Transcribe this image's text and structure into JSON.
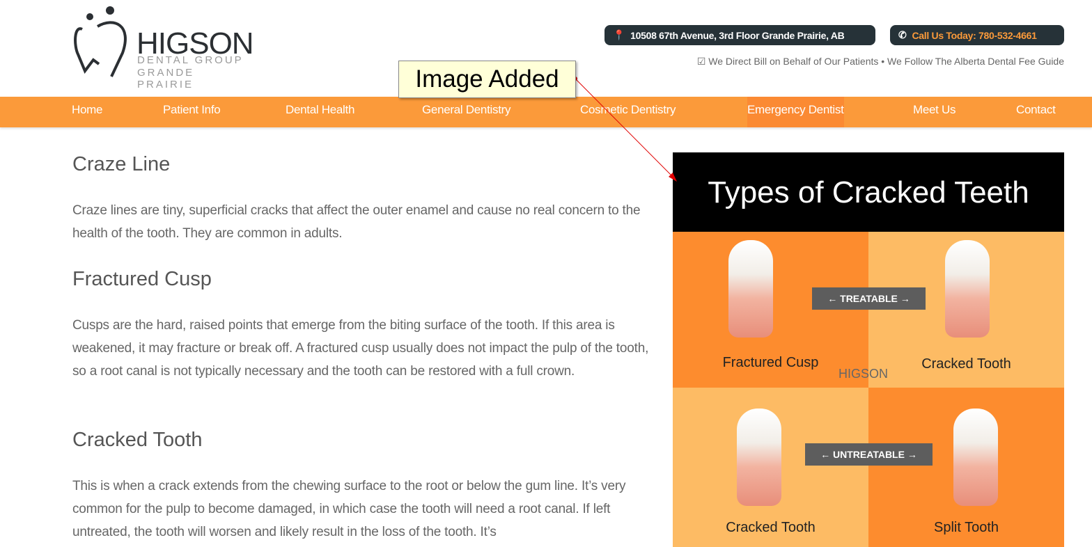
{
  "logo": {
    "brand": "HIGSON",
    "line1": "DENTAL GROUP",
    "line2": "GRANDE PRAIRIE"
  },
  "header": {
    "address": "10508 67th Avenue, 3rd Floor Grande Prairie, AB",
    "phone": "Call Us Today: 780-532-4661",
    "tagline": "We Direct Bill on Behalf of Our Patients • We Follow The Alberta Dental Fee Guide"
  },
  "nav": {
    "items": [
      {
        "label": "Home"
      },
      {
        "label": "Patient Info"
      },
      {
        "label": "Dental Health"
      },
      {
        "label": "General Dentistry"
      },
      {
        "label": "Cosmetic Dentistry"
      },
      {
        "label": "Emergency Dentist",
        "active": true
      },
      {
        "label": "Meet Us"
      },
      {
        "label": "Contact"
      }
    ]
  },
  "annotation": {
    "label": "Image Added",
    "color": "#e00000"
  },
  "content": {
    "sections": [
      {
        "heading": "Craze Line",
        "body": "Craze lines are tiny, superficial cracks that affect the outer enamel and cause no real concern to the health of the tooth. They are common in adults."
      },
      {
        "heading": "Fractured Cusp",
        "body": "Cusps are the hard, raised points that emerge from the biting surface of the tooth. If this area is weakened, it may fracture or break off. A fractured cusp usually does not impact the pulp of the tooth, so a root canal is not typically necessary and the tooth can be restored with a full crown."
      },
      {
        "heading": "Cracked Tooth",
        "body": "This is when a crack extends from the chewing surface to the root or below the gum line. It’s very common for the pulp to become damaged, in which case the tooth will need a root canal. If left untreated, the tooth will worsen and likely result in the loss of the tooth. It’s"
      }
    ]
  },
  "infographic": {
    "title": "Types of Cracked Teeth",
    "treatable": "TREATABLE",
    "untreatable": "UNTREATABLE",
    "watermark": "HIGSON",
    "labels": [
      "Fractured Cusp",
      "Cracked Tooth",
      "Cracked Tooth",
      "Split Tooth"
    ]
  },
  "colors": {
    "accent": "#fb9a3a",
    "dark": "#263238",
    "phone": "#fb9a3a"
  }
}
